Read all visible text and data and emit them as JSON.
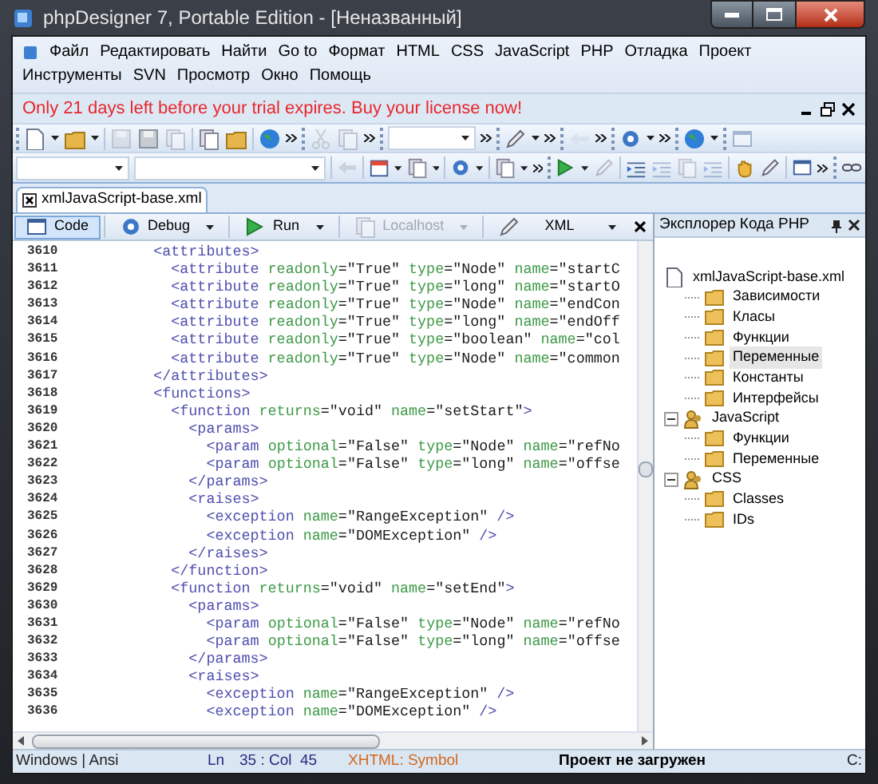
{
  "window": {
    "title": "phpDesigner 7, Portable Edition - [Неназванный]"
  },
  "menu": [
    "Файл",
    "Редактировать",
    "Найти",
    "Go to",
    "Формат",
    "HTML",
    "CSS",
    "JavaScript",
    "PHP",
    "Отладка",
    "Проект",
    "Инструменты",
    "SVN",
    "Просмотр",
    "Окно",
    "Помощь"
  ],
  "trial_notice": "Only 21 days left before your trial expires. Buy your license now!",
  "document_tabs": [
    {
      "label": "xmlJavaScript-base.xml",
      "selected": true
    }
  ],
  "editor_toolbar": [
    {
      "label": "Code",
      "selected": true,
      "dropdown": false,
      "disabled": false
    },
    {
      "label": "Debug",
      "selected": false,
      "dropdown": true,
      "disabled": false
    },
    {
      "label": "Run",
      "selected": false,
      "dropdown": true,
      "disabled": false
    },
    {
      "label": "Localhost",
      "selected": false,
      "dropdown": true,
      "disabled": true
    },
    {
      "label": "XML",
      "selected": false,
      "dropdown": true,
      "disabled": false
    }
  ],
  "code_lines": [
    {
      "number": "3610",
      "text": "        <attributes>"
    },
    {
      "number": "3611",
      "text": "          <attribute readonly=\"True\" type=\"Node\" name=\"startC"
    },
    {
      "number": "3612",
      "text": "          <attribute readonly=\"True\" type=\"long\" name=\"startO"
    },
    {
      "number": "3613",
      "text": "          <attribute readonly=\"True\" type=\"Node\" name=\"endCon"
    },
    {
      "number": "3614",
      "text": "          <attribute readonly=\"True\" type=\"long\" name=\"endOff"
    },
    {
      "number": "3615",
      "text": "          <attribute readonly=\"True\" type=\"boolean\" name=\"col"
    },
    {
      "number": "3616",
      "text": "          <attribute readonly=\"True\" type=\"Node\" name=\"common"
    },
    {
      "number": "3617",
      "text": "        </attributes>"
    },
    {
      "number": "3618",
      "text": "        <functions>"
    },
    {
      "number": "3619",
      "text": "          <function returns=\"void\" name=\"setStart\">"
    },
    {
      "number": "3620",
      "text": "            <params>"
    },
    {
      "number": "3621",
      "text": "              <param optional=\"False\" type=\"Node\" name=\"refNo"
    },
    {
      "number": "3622",
      "text": "              <param optional=\"False\" type=\"long\" name=\"offse"
    },
    {
      "number": "3623",
      "text": "            </params>"
    },
    {
      "number": "3624",
      "text": "            <raises>"
    },
    {
      "number": "3625",
      "text": "              <exception name=\"RangeException\" />"
    },
    {
      "number": "3626",
      "text": "              <exception name=\"DOMException\" />"
    },
    {
      "number": "3627",
      "text": "            </raises>"
    },
    {
      "number": "3628",
      "text": "          </function>"
    },
    {
      "number": "3629",
      "text": "          <function returns=\"void\" name=\"setEnd\">"
    },
    {
      "number": "3630",
      "text": "            <params>"
    },
    {
      "number": "3631",
      "text": "              <param optional=\"False\" type=\"Node\" name=\"refNo"
    },
    {
      "number": "3632",
      "text": "              <param optional=\"False\" type=\"long\" name=\"offse"
    },
    {
      "number": "3633",
      "text": "            </params>"
    },
    {
      "number": "3634",
      "text": "            <raises>"
    },
    {
      "number": "3635",
      "text": "              <exception name=\"RangeException\" />"
    },
    {
      "number": "3636",
      "text": "              <exception name=\"DOMException\" />"
    }
  ],
  "explorer": {
    "title": "Эксплорер Кода PHP",
    "tree": [
      {
        "label": "xmlJavaScript-base.xml",
        "kind": "file",
        "selected": false,
        "children": [
          {
            "label": "Зависимости",
            "kind": "folder",
            "selected": false
          },
          {
            "label": "Класы",
            "kind": "folder",
            "selected": false
          },
          {
            "label": "Функции",
            "kind": "folder",
            "selected": false
          },
          {
            "label": "Переменные",
            "kind": "folder",
            "selected": true
          },
          {
            "label": "Константы",
            "kind": "folder",
            "selected": false
          },
          {
            "label": "Интерфейсы",
            "kind": "folder",
            "selected": false
          }
        ]
      },
      {
        "label": "JavaScript",
        "kind": "group",
        "selected": false,
        "expanded": true,
        "children": [
          {
            "label": "Функции",
            "kind": "folder",
            "selected": false
          },
          {
            "label": "Переменные",
            "kind": "folder",
            "selected": false
          }
        ]
      },
      {
        "label": "CSS",
        "kind": "group",
        "selected": false,
        "expanded": true,
        "children": [
          {
            "label": "Classes",
            "kind": "folder",
            "selected": false
          },
          {
            "label": "IDs",
            "kind": "folder",
            "selected": false
          }
        ]
      }
    ]
  },
  "status_bar": {
    "encoding": "Windows | Ansi",
    "ln_label": "Ln",
    "position": "35 : Col  45",
    "syntax": "XHTML: Symbol",
    "project": "Проект не загружен",
    "drive": "C:"
  }
}
